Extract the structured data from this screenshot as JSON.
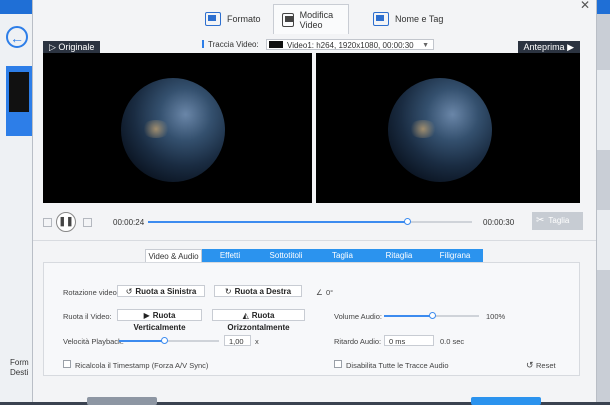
{
  "tabs": [
    {
      "label": "Formato"
    },
    {
      "label": "Modifica Video"
    },
    {
      "label": "Nome e Tag"
    }
  ],
  "background": {
    "back_icon": "arrow-left-icon",
    "format_label": "Form Desti"
  },
  "header": {
    "original_label": "Originale",
    "preview_label": "Anteprima",
    "track_label": "Traccia Video:",
    "track_value": "Video1: h264, 1920x1080, 00:00:30"
  },
  "player": {
    "current_time": "00:00:24",
    "total_time": "00:00:30",
    "progress": 0.8,
    "cut_label": "Taglia"
  },
  "subtabs": [
    {
      "label": "Video & Audio"
    },
    {
      "label": "Effetti"
    },
    {
      "label": "Sottotitoli"
    },
    {
      "label": "Taglia"
    },
    {
      "label": "Ritaglia"
    },
    {
      "label": "Filigrana"
    }
  ],
  "panel": {
    "rotation_label": "Rotazione video:",
    "rotate_left": "Ruota a Sinistra",
    "rotate_right": "Ruota a Destra",
    "rotation_value": "0°",
    "flip_label": "Ruota il Video:",
    "flip_vertical": "Ruota Verticalmente",
    "flip_horizontal": "Ruota Orizzontalmente",
    "volume_label": "Volume Audio:",
    "volume_value": "100%",
    "volume_level": 0.5,
    "speed_label": "Velocità Playback:",
    "speed_value": "1,00",
    "speed_unit": "x",
    "speed_level": 0.45,
    "delay_label": "Ritardo Audio:",
    "delay_value": "0 ms",
    "delay_display": "0.0 sec",
    "timestamp_label": "Ricalcola il Timestamp (Forza A/V Sync)",
    "disable_tracks_label": "Disabilita Tutte le Tracce Audio",
    "reset_label": "Reset"
  },
  "colors": {
    "accent": "#2b93ee"
  }
}
